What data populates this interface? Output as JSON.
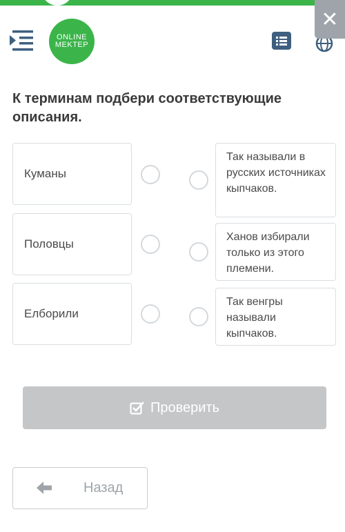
{
  "header": {
    "logo_line1": "ONLINE",
    "logo_line2": "MEKTEP",
    "close_glyph": "✕",
    "icons": [
      "menu-icon",
      "list-icon",
      "globe-icon",
      "close-icon"
    ]
  },
  "question": "К терминам подбери соответствующие описания.",
  "terms": [
    {
      "label": "Куманы"
    },
    {
      "label": "Половцы"
    },
    {
      "label": "Елборили"
    }
  ],
  "descriptions": [
    {
      "text": "Так называли в русских источниках кыпчаков."
    },
    {
      "text": "Ханов избирали только из этого племени."
    },
    {
      "text": "Так венгры называли кыпчаков."
    }
  ],
  "buttons": {
    "check_label": "Проверить",
    "back_label": "Назад"
  },
  "colors": {
    "brand_green": "#3bb54a",
    "disabled_button": "#c4c6c8",
    "close_button": "#9ea4a9",
    "list_icon": "#3e5f7f"
  }
}
